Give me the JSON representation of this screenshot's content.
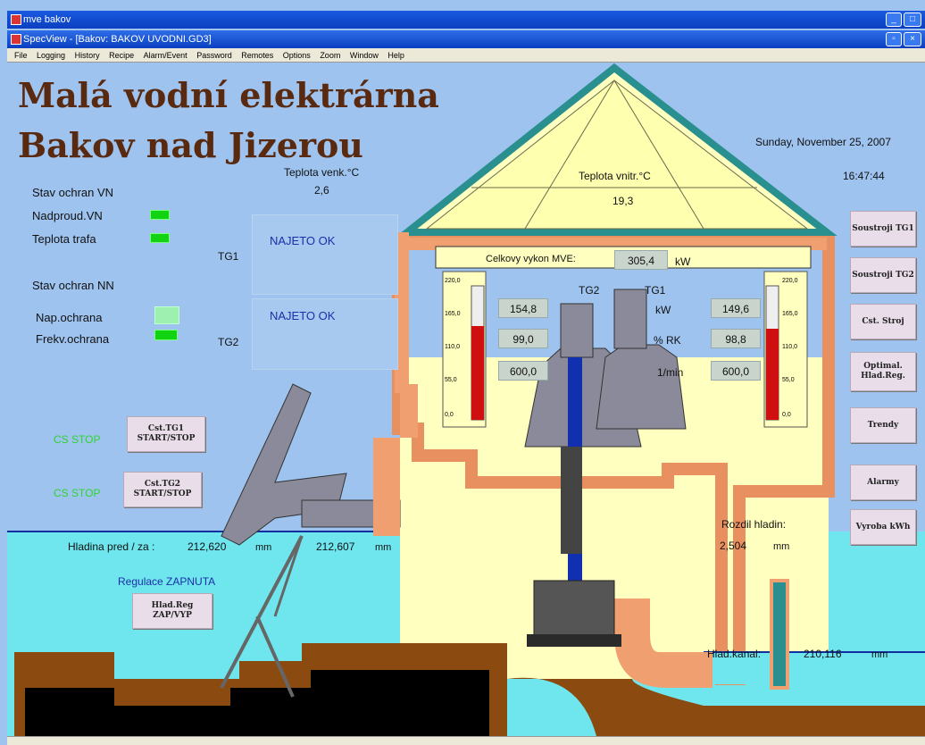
{
  "window": {
    "outer_title": "mve bakov",
    "inner_title": "SpecView - [Bakov: BAKOV UVODNI.GD3]",
    "menu": [
      "File",
      "Logging",
      "History",
      "Recipe",
      "Alarm/Event",
      "Password",
      "Remotes",
      "Options",
      "Zoom",
      "Window",
      "Help"
    ]
  },
  "header": {
    "title_line1": "Malá vodní elektrárna",
    "title_line2": "Bakov nad Jizerou",
    "date": "Sunday, November 25, 2007",
    "time": "16:47:44"
  },
  "temperatures": {
    "outdoor_label": "Teplota venk.°C",
    "outdoor_value": "2,6",
    "indoor_label": "Teplota vnitr.°C",
    "indoor_value": "19,3"
  },
  "protection": {
    "vn_title": "Stav ochran VN",
    "vn_items": [
      "Nadproud.VN",
      "Teplota trafa"
    ],
    "nn_title": "Stav ochran NN",
    "nn_items": [
      "Nap.ochrana",
      "Frekv.ochrana"
    ]
  },
  "generators": {
    "tg1_label": "TG1",
    "tg2_label": "TG2",
    "tg1_status": "NAJETO OK",
    "tg2_status": "NAJETO OK",
    "cs_stop_1": "CS STOP",
    "cs_stop_2": "CS STOP",
    "btn_tg1": "Cst.TG1 START/STOP",
    "btn_tg2": "Cst.TG2 START/STOP"
  },
  "power": {
    "total_label": "Celkovy vykon MVE:",
    "total_value": "305,4",
    "total_unit": "kW",
    "col_tg2": "TG2",
    "col_tg1": "TG1",
    "rows": [
      {
        "tg2": "154,8",
        "unit": "kW",
        "tg1": "149,6"
      },
      {
        "tg2": "99,0",
        "unit": "% RK",
        "tg1": "98,8"
      },
      {
        "tg2": "600,0",
        "unit": "1/min",
        "tg1": "600,0"
      }
    ],
    "gauge_ticks": [
      "220,0",
      "165,0",
      "110,0",
      "55,0",
      "0,0"
    ],
    "gauge_left_level": 0.7,
    "gauge_right_level": 0.68
  },
  "levels": {
    "head_label": "Hladina pred / za :",
    "head_before": "212,620",
    "head_unit1": "mm",
    "head_after": "212,607",
    "head_unit2": "mm",
    "diff_label": "Rozdil hladin:",
    "diff_value": "2,504",
    "diff_unit": "mm",
    "channel_label": "Hlad.kanal:",
    "channel_value": "210,116",
    "channel_unit": "mm",
    "regulation_status": "Regulace ZAPNUTA",
    "btn_regulation": "Hlad.Reg ZAP/VYP"
  },
  "right_buttons": [
    "Soustroji TG1",
    "Soustroji TG2",
    "Cst. Stroj",
    "Optimal. Hlad.Reg.",
    "Trendy",
    "Alarmy",
    "Vyroba kWh"
  ],
  "colors": {
    "sky": "#9ec3ef",
    "water": "#6fe6ee",
    "building": "#ffffc0",
    "brick": "#f0a070",
    "roof": "#2a8f8f",
    "ground": "#8a4a10",
    "led_on": "#12d312"
  }
}
